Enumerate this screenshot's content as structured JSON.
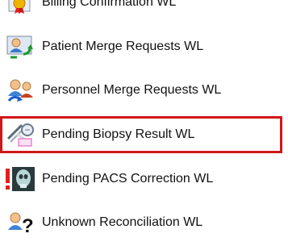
{
  "worklists": [
    {
      "label": "Billing Confirmation WL",
      "icon": "billing-icon"
    },
    {
      "label": "Patient Merge Requests WL",
      "icon": "patient-merge-icon"
    },
    {
      "label": "Personnel Merge Requests WL",
      "icon": "personnel-merge-icon"
    },
    {
      "label": "Pending Biopsy Result WL",
      "icon": "biopsy-icon",
      "selected": true
    },
    {
      "label": "Pending PACS Correction WL",
      "icon": "pacs-icon"
    },
    {
      "label": "Unknown Reconciliation WL",
      "icon": "unknown-reconciliation-icon"
    }
  ],
  "colors": {
    "selection_border": "#d01818"
  }
}
